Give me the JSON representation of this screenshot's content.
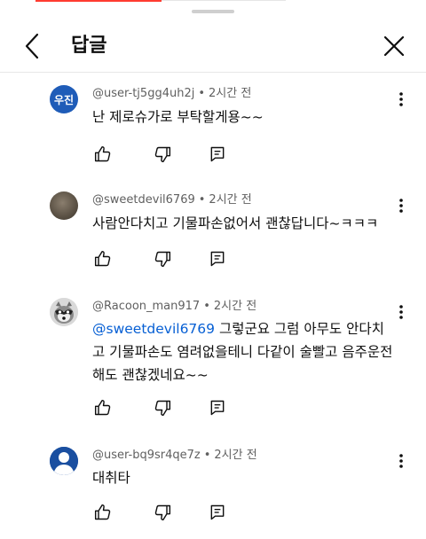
{
  "header": {
    "title": "답글"
  },
  "replies": [
    {
      "author": "@user-tj5gg4uh2j",
      "separator": "•",
      "time": "2시간 전",
      "avatar_text": "우진",
      "text": "난 제로슈가로 부탁할게용~~"
    },
    {
      "author": "@sweetdevil6769",
      "separator": "•",
      "time": "2시간 전",
      "avatar_text": "",
      "text": "사람안다치고 기물파손없어서 괜찮답니다~ㅋㅋㅋ"
    },
    {
      "author": "@Racoon_man917",
      "separator": "•",
      "time": "2시간 전",
      "avatar_text": "",
      "mention": "@sweetdevil6769",
      "text": " 그렇군요 그럼 아무도 안다치고 기물파손도 염려없을테니 다같이 술빨고 음주운전해도 괜찮겠네요~~"
    },
    {
      "author": "@user-bq9sr4qe7z",
      "separator": "•",
      "time": "2시간 전",
      "avatar_text": "",
      "text": "대취타"
    }
  ],
  "colors": {
    "mention": "#065fd4",
    "avatar_blue": "#1f5cb8",
    "meta_gray": "#606060"
  },
  "icons": [
    "back-arrow-icon",
    "close-icon",
    "more-vert-icon",
    "thumb-up-icon",
    "thumb-down-icon",
    "reply-comment-icon"
  ]
}
